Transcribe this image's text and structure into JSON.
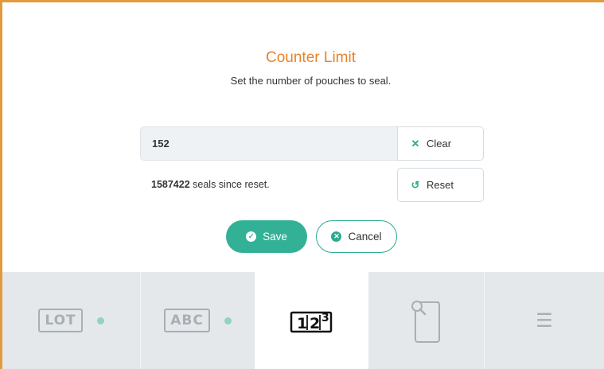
{
  "dialog": {
    "title": "Counter Limit",
    "subtitle": "Set the number of pouches to seal.",
    "count_value": "152",
    "clear_label": "Clear",
    "reset_label": "Reset",
    "seals_count": "1587422",
    "seals_suffix": " seals since reset.",
    "save_label": "Save",
    "cancel_label": "Cancel"
  },
  "icons": {
    "clear": "x-icon",
    "reset": "undo-icon",
    "save": "check-circle-icon",
    "cancel": "x-circle-icon"
  },
  "tabs": {
    "lot": "LOT",
    "abc": "ABC",
    "counter": "counter-icon",
    "pouch": "pouch-search-icon",
    "menu": "menu-icon",
    "active": "counter"
  },
  "colors": {
    "accent": "#33b196",
    "title": "#e8822a",
    "frame": "#e39a3b",
    "tabbar": "#e5e8eb",
    "indicator": "#8fd3c4"
  }
}
